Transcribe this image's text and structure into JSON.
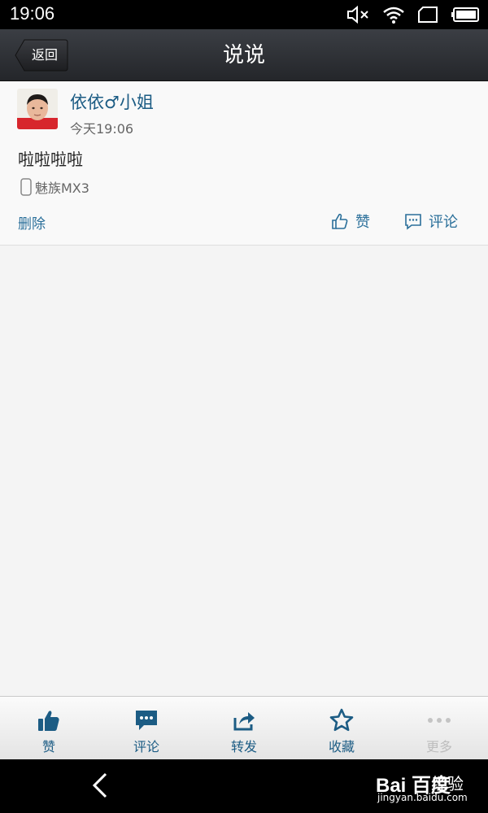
{
  "status_bar": {
    "time": "19:06",
    "icons": [
      "mute-icon",
      "wifi-icon",
      "tablet-icon",
      "battery-icon"
    ]
  },
  "title_bar": {
    "back_label": "返回",
    "title": "说说"
  },
  "post": {
    "author": "依依♂小姐",
    "time": "今天19:06",
    "content": "啦啦啦啦",
    "device": "魅族MX3",
    "delete_label": "删除",
    "like_label": "赞",
    "comment_label": "评论"
  },
  "toolbar": {
    "items": [
      {
        "label": "赞",
        "icon": "thumbs-up-icon"
      },
      {
        "label": "评论",
        "icon": "comment-icon"
      },
      {
        "label": "转发",
        "icon": "share-icon"
      },
      {
        "label": "收藏",
        "icon": "star-icon"
      },
      {
        "label": "更多",
        "icon": "more-icon"
      }
    ]
  },
  "watermark": {
    "brand": "Bai 百度",
    "label": "经验",
    "url": "jingyan.baidu.com"
  },
  "colors": {
    "link": "#2a6f9a",
    "author": "#1c5c84",
    "title_bar": "#2f3236"
  }
}
